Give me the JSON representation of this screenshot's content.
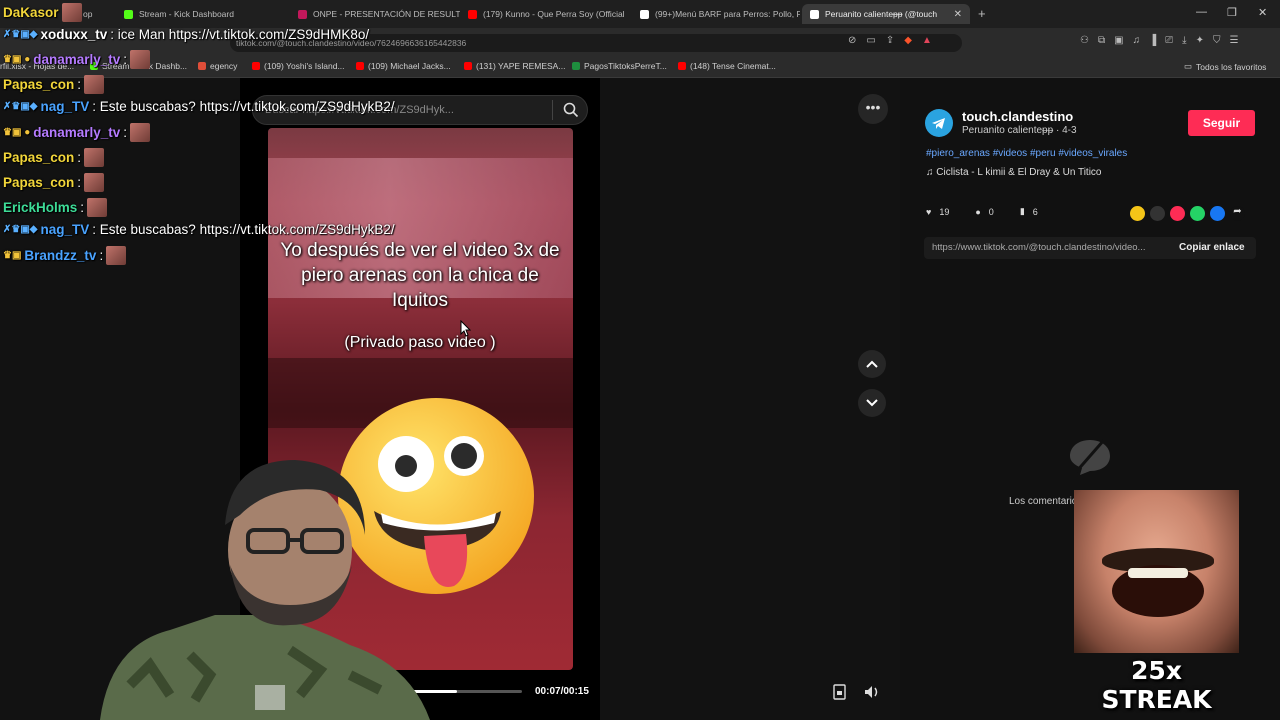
{
  "browser": {
    "tabs": [
      {
        "label": "op",
        "icon": "sheets-icon",
        "color": "#1e8e3e"
      },
      {
        "label": "Stream - Kick Dashboard",
        "icon": "kick-icon",
        "color": "#53fc18"
      },
      {
        "label": "ONPE - PRESENTACIÓN DE RESULTA",
        "icon": "onpe-icon",
        "color": "#c2185b"
      },
      {
        "label": "(179) Kunno - Que Perra Soy (Official",
        "icon": "youtube-icon",
        "color": "#ff0000"
      },
      {
        "label": "(99+)Menú BARF para Perros: Pollo, F",
        "icon": "tiktok-icon",
        "color": "#ffffff"
      },
      {
        "label": "Peruanito calienteᵽᵽ (@touch",
        "icon": "tiktok-icon",
        "color": "#ffffff"
      }
    ],
    "url": "tiktok.com/@touch.clandestino/video/7624696636165442836",
    "bookmarks": [
      {
        "label": "rfil.xlsx - Hojas de...",
        "color": "#1e8e3e"
      },
      {
        "label": "Stream - Kick Dashb...",
        "color": "#53fc18"
      },
      {
        "label": "egency",
        "color": "#e04e39"
      },
      {
        "label": "(109) Yoshi's Island...",
        "color": "#ff0000"
      },
      {
        "label": "(109) Michael Jacks...",
        "color": "#ff0000"
      },
      {
        "label": "(131) YAPE REMESA...",
        "color": "#ff0000"
      },
      {
        "label": "PagosTiktoksPerreT...",
        "color": "#1e8e3e"
      },
      {
        "label": "(148) Tense Cinemat...",
        "color": "#ff0000"
      }
    ],
    "all_favorites": "Todos los favoritos"
  },
  "tiktok": {
    "search_placeholder": "Buscar https://vt.tiktok.com/ZS9dHyk...",
    "video": {
      "caption": "Yo después de ver el video 3x de piero arenas con la chica de Iquitos",
      "sub_caption": "(Privado paso video )",
      "time": "00:07/00:15",
      "progress": 0.47
    },
    "author": {
      "name": "touch.clandestino",
      "display": "Peruanito calienteᵽᵽ · 4-3",
      "follow_label": "Seguir"
    },
    "hashtags": "#piero_arenas #videos #peru #videos_virales",
    "music": "Ciclista - L kimii & El Dray & Un Titico",
    "stats": {
      "likes": "19",
      "comments": "0",
      "saves": "6"
    },
    "link": "https://www.tiktok.com/@touch.clandestino/video...",
    "copy_label": "Copiar enlace",
    "comments_label": "Los comentarios..."
  },
  "chat": [
    {
      "user": "DaKasor",
      "color": "#f2d63a",
      "msg": ""
    },
    {
      "user": "xoduxx_tv",
      "color": "#ffffff",
      "msg": ": ice Man https://vt.tiktok.com/ZS9dHMK8o/"
    },
    {
      "user": "danamarly_tv",
      "color": "#b57bff",
      "msg": ":"
    },
    {
      "user": "Papas_con",
      "color": "#f2d63a",
      "msg": ":"
    },
    {
      "user": "nag_TV",
      "color": "#4aa3ff",
      "msg": ": Este buscabas? https://vt.tiktok.com/ZS9dHyk​B2/"
    },
    {
      "user": "danamarly_tv",
      "color": "#b57bff",
      "msg": ":"
    },
    {
      "user": "Papas_con",
      "color": "#f2d63a",
      "msg": ":"
    },
    {
      "user": "Papas_con",
      "color": "#f2d63a",
      "msg": ":"
    },
    {
      "user": "ErickHolms",
      "color": "#3ddc97",
      "msg": ":"
    },
    {
      "user": "nag_TV",
      "color": "#4aa3ff",
      "msg": ": Este buscabas? https://vt.tiktok.com/ZS9dHykB2/"
    },
    {
      "user": "Brandzz_tv",
      "color": "#4aa3ff",
      "msg": ":"
    }
  ],
  "streak": {
    "label": "25x STREAK"
  }
}
